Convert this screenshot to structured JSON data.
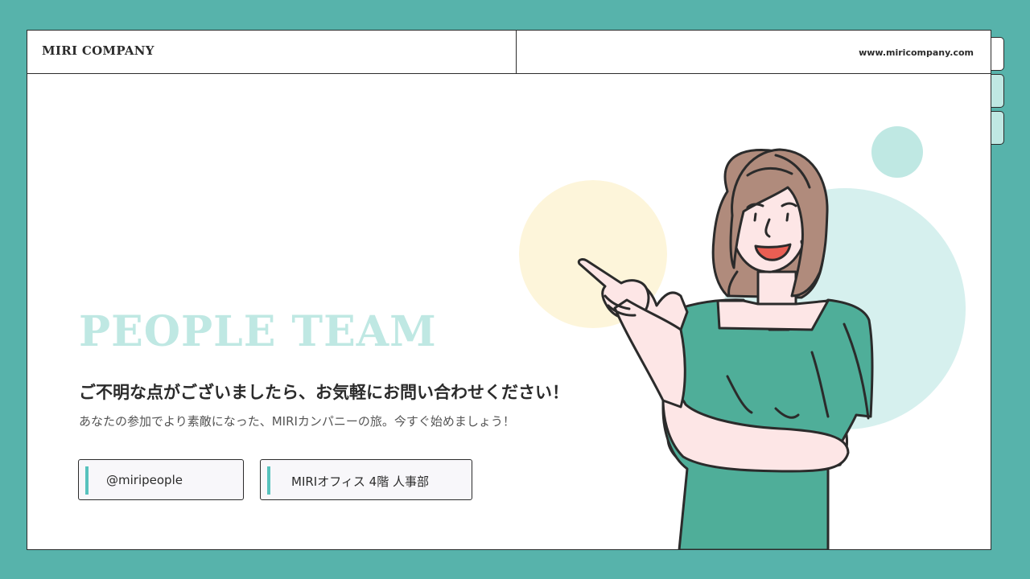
{
  "header": {
    "brand": "MIRI COMPANY",
    "url": "www.miricompany.com"
  },
  "hero": {
    "title": "PEOPLE TEAM",
    "headline": "ご不明な点がございましたら、お気軽にお問い合わせください！",
    "subline": "あなたの参加でより素敵になった、MIRIカンパニーの旅。今すぐ始めましょう！"
  },
  "contacts": [
    {
      "label": "@miripeople"
    },
    {
      "label": "MIRIオフィス 4階 人事部"
    }
  ],
  "colors": {
    "background": "#57b3ab",
    "title_accent": "#bfe8e3",
    "dress": "#4fae99",
    "hair": "#b08b7c",
    "circle_yellow": "#fdf5da",
    "circle_mint": "#d6f0ee"
  }
}
